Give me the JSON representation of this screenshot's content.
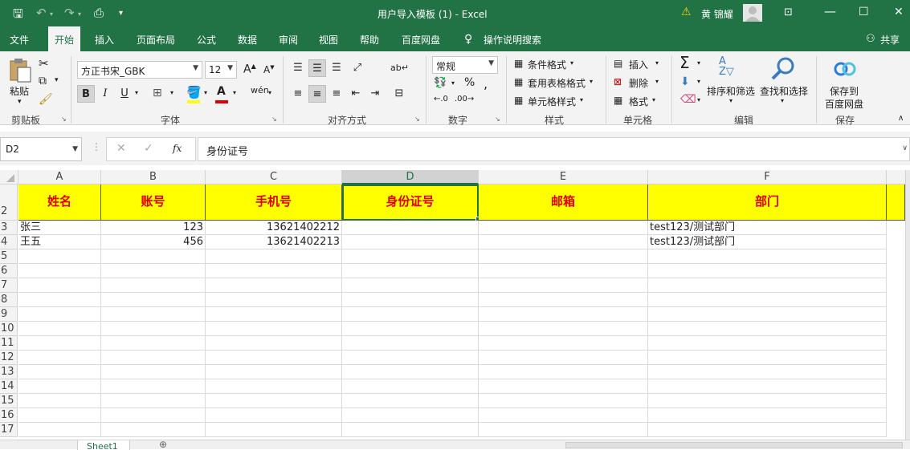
{
  "titlebar": {
    "title": "用户导入模板 (1)  -  Excel",
    "user": "黄 锦耀"
  },
  "tabs": [
    "文件",
    "开始",
    "插入",
    "页面布局",
    "公式",
    "数据",
    "审阅",
    "视图",
    "帮助",
    "百度网盘"
  ],
  "active_tab": "开始",
  "tell_me": "操作说明搜索",
  "share": "共享",
  "ribbon": {
    "clipboard": {
      "paste": "粘贴",
      "label": "剪贴板"
    },
    "font": {
      "name": "方正书宋_GBK",
      "size": "12",
      "label": "字体",
      "bold": "B",
      "italic": "I",
      "underline": "U"
    },
    "alignment": {
      "label": "对齐方式"
    },
    "number": {
      "format": "常规",
      "label": "数字"
    },
    "styles": {
      "conditional": "条件格式",
      "table": "套用表格格式",
      "cell_styles": "单元格样式",
      "label": "样式"
    },
    "cells": {
      "insert": "插入",
      "delete": "删除",
      "format": "格式",
      "label": "单元格"
    },
    "editing": {
      "sort": "排序和筛选",
      "find": "查找和选择",
      "label": "编辑"
    },
    "save": {
      "save_to": "保存到",
      "baidu": "百度网盘",
      "label": "保存"
    }
  },
  "formula_bar": {
    "name_box": "D2",
    "content": "身份证号"
  },
  "columns": [
    "A",
    "B",
    "C",
    "D",
    "E",
    "F"
  ],
  "selected_column": "D",
  "header_row": [
    "姓名",
    "账号",
    "手机号",
    "身份证号",
    "邮箱",
    "部门"
  ],
  "data_rows": [
    {
      "row": "3",
      "name": "张三",
      "account": "123",
      "phone": "13621402212",
      "dept": "test123/测试部门"
    },
    {
      "row": "4",
      "name": "王五",
      "account": "456",
      "phone": "13621402213",
      "dept": "test123/测试部门"
    }
  ],
  "empty_rows": [
    "5",
    "6",
    "7",
    "8",
    "9",
    "10",
    "11",
    "12",
    "13",
    "14",
    "15",
    "16",
    "17"
  ],
  "header_row_number": "2",
  "sheet_tab": "Sheet1",
  "colors": {
    "accent": "#217346",
    "header_fill": "#ffff00",
    "header_text": "#e00000"
  }
}
